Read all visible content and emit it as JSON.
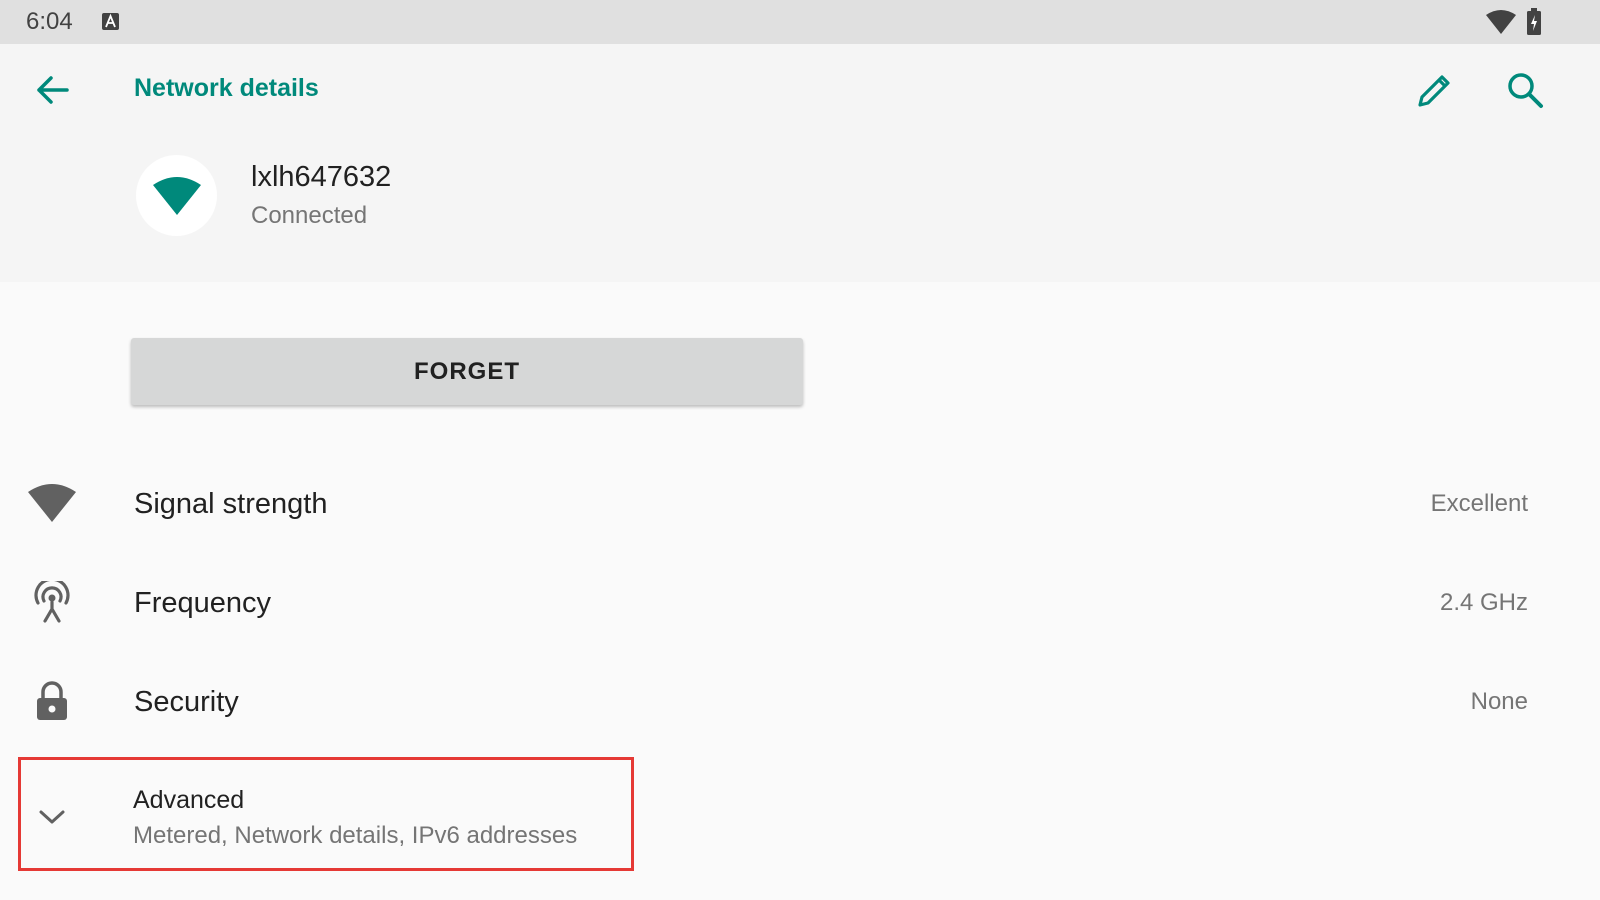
{
  "status_bar": {
    "time": "6:04",
    "icons": [
      "a-notification-icon",
      "wifi-icon",
      "battery-charging-icon"
    ]
  },
  "toolbar": {
    "title": "Network details",
    "back_icon": "back-arrow-icon",
    "edit_icon": "edit-pencil-icon",
    "search_icon": "search-icon"
  },
  "network": {
    "name": "lxlh647632",
    "status": "Connected",
    "icon": "wifi-icon"
  },
  "forget_button": {
    "label": "FORGET"
  },
  "details": [
    {
      "title": "Signal strength",
      "value": "Excellent",
      "icon": "wifi-signal-icon"
    },
    {
      "title": "Frequency",
      "value": "2.4 GHz",
      "icon": "antenna-icon"
    },
    {
      "title": "Security",
      "value": "None",
      "icon": "lock-icon"
    }
  ],
  "advanced": {
    "title": "Advanced",
    "summary": "Metered, Network details, IPv6 addresses",
    "icon": "chevron-down-icon"
  },
  "colors": {
    "accent": "#00897b",
    "status_bar": "#e0e0e0",
    "header_bg": "#f5f5f5",
    "page_bg": "#fafafa",
    "highlight_border": "#e53935"
  }
}
